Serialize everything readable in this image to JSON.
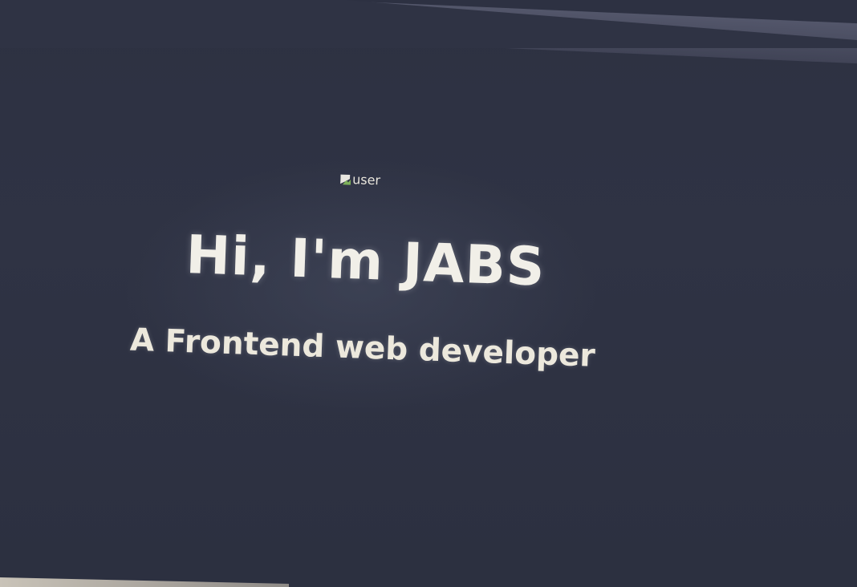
{
  "hero": {
    "avatar_alt": "user",
    "title": "Hi, I'm JABS",
    "subtitle": "A Frontend web developer"
  },
  "colors": {
    "background": "#2f3344",
    "text": "#f1efe8"
  },
  "icons": {
    "avatar": "broken-image-icon"
  }
}
